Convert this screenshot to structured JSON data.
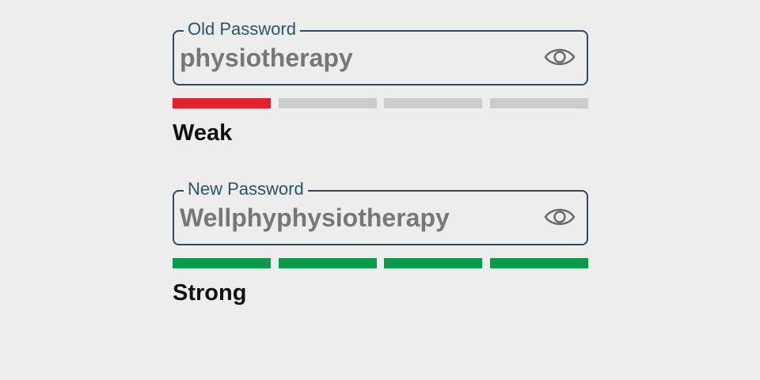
{
  "colors": {
    "weak": "#e3212a",
    "strong": "#0a9a4a",
    "empty": "#cccccc"
  },
  "old_password": {
    "label": "Old Password",
    "value": "physiotherapy",
    "toggle_icon": "eye-icon",
    "strength_label": "Weak",
    "strength_level": 1,
    "strength_segments": 4
  },
  "new_password": {
    "label": "New Password",
    "value": "Wellphyphysiotherapy",
    "toggle_icon": "eye-icon",
    "strength_label": "Strong",
    "strength_level": 4,
    "strength_segments": 4
  }
}
